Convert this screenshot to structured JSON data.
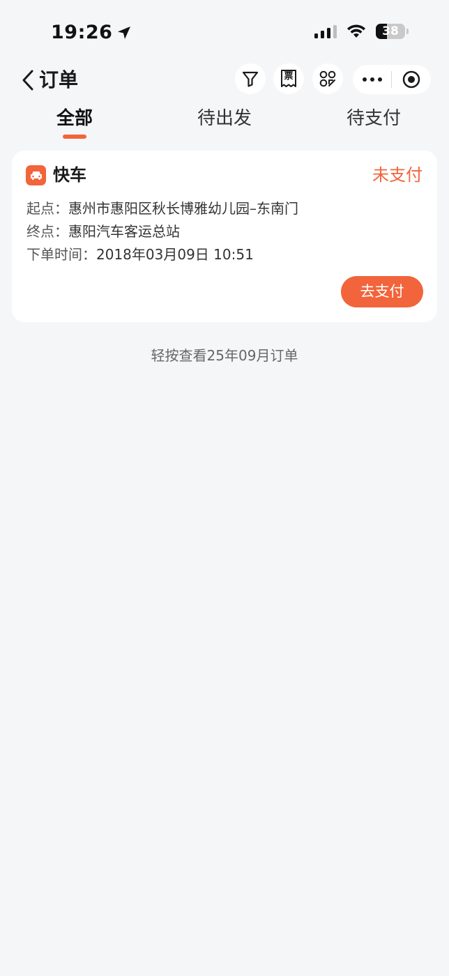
{
  "status_bar": {
    "time": "19:26",
    "battery_level": 38,
    "battery_text": "38"
  },
  "nav": {
    "title": "订单",
    "icons": [
      "back-icon",
      "filter-icon",
      "invoice-icon",
      "scan-icon",
      "more-icon",
      "close-icon"
    ],
    "invoice_glyph": "票"
  },
  "tabs": [
    {
      "label": "全部",
      "active": true
    },
    {
      "label": "待出发",
      "active": false
    },
    {
      "label": "待支付",
      "active": false
    }
  ],
  "orders": [
    {
      "service": "快车",
      "status": "未支付",
      "origin_label": "起点：",
      "origin": "惠州市惠阳区秋长博雅幼儿园–东南门",
      "destination_label": "终点：",
      "destination": "惠阳汽车客运总站",
      "time_label": "下单时间：",
      "time": "2018年03月09日 10:51",
      "action_label": "去支付"
    }
  ],
  "history_link": "轻按查看25年09月订单",
  "colors": {
    "accent": "#f2643b",
    "background": "#f5f6f8",
    "card": "#ffffff"
  }
}
